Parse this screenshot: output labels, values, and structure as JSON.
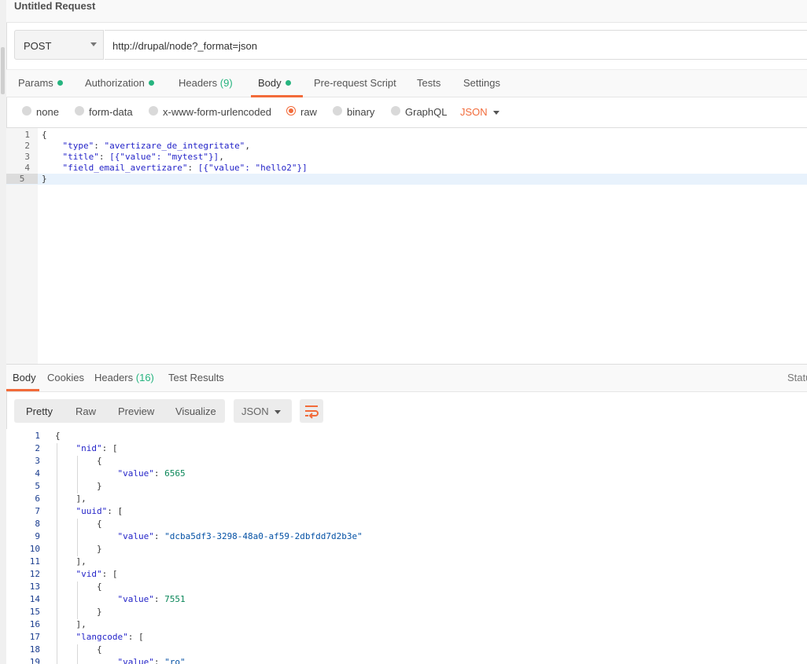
{
  "window": {
    "title": "Untitled Request"
  },
  "request": {
    "method": "POST",
    "url": "http://drupal/node?_format=json",
    "tabs": [
      {
        "label": "Params",
        "dot": true
      },
      {
        "label": "Authorization",
        "dot": true
      },
      {
        "label": "Headers",
        "count": "(9)"
      },
      {
        "label": "Body",
        "dot": true,
        "active": true
      },
      {
        "label": "Pre-request Script"
      },
      {
        "label": "Tests"
      },
      {
        "label": "Settings"
      }
    ],
    "body_types": [
      "none",
      "form-data",
      "x-www-form-urlencoded",
      "raw",
      "binary",
      "GraphQL"
    ],
    "selected_body_type": "raw",
    "raw_format": "JSON",
    "body_lines": [
      {
        "n": "1",
        "text": "{"
      },
      {
        "n": "2",
        "key": "\"type\"",
        "val": "\"avertizare_de_integritate\"",
        "tail": ","
      },
      {
        "n": "3",
        "key": "\"title\"",
        "val": "[{\"value\": \"mytest\"}]",
        "tail": ","
      },
      {
        "n": "4",
        "key": "\"field_email_avertizare\"",
        "val": "[{\"value\": \"hello2\"}]",
        "tail": ""
      },
      {
        "n": "5",
        "text": "}"
      }
    ]
  },
  "response": {
    "tabs": [
      {
        "label": "Body",
        "active": true
      },
      {
        "label": "Cookies"
      },
      {
        "label": "Headers",
        "count": "(16)"
      },
      {
        "label": "Test Results"
      }
    ],
    "status_label": "Statu",
    "view_modes": [
      "Pretty",
      "Raw",
      "Preview",
      "Visualize"
    ],
    "active_view": "Pretty",
    "format": "JSON",
    "lines": [
      {
        "n": "1",
        "text": "{"
      },
      {
        "n": "2",
        "text": "\"nid\": ["
      },
      {
        "n": "3",
        "text": "{"
      },
      {
        "n": "4",
        "key": "\"value\"",
        "num": "6565"
      },
      {
        "n": "5",
        "text": "}"
      },
      {
        "n": "6",
        "text": "],"
      },
      {
        "n": "7",
        "text": "\"uuid\": ["
      },
      {
        "n": "8",
        "text": "{"
      },
      {
        "n": "9",
        "key": "\"value\"",
        "str": "\"dcba5df3-3298-48a0-af59-2dbfdd7d2b3e\""
      },
      {
        "n": "10",
        "text": "}"
      },
      {
        "n": "11",
        "text": "],"
      },
      {
        "n": "12",
        "text": "\"vid\": ["
      },
      {
        "n": "13",
        "text": "{"
      },
      {
        "n": "14",
        "key": "\"value\"",
        "num": "7551"
      },
      {
        "n": "15",
        "text": "}"
      },
      {
        "n": "16",
        "text": "],"
      },
      {
        "n": "17",
        "text": "\"langcode\": ["
      },
      {
        "n": "18",
        "text": "{"
      },
      {
        "n": "19",
        "key": "\"value\"",
        "str": "\"ro\""
      }
    ]
  },
  "colors": {
    "accent": "#f26b3a",
    "indicator": "#26b47f"
  }
}
